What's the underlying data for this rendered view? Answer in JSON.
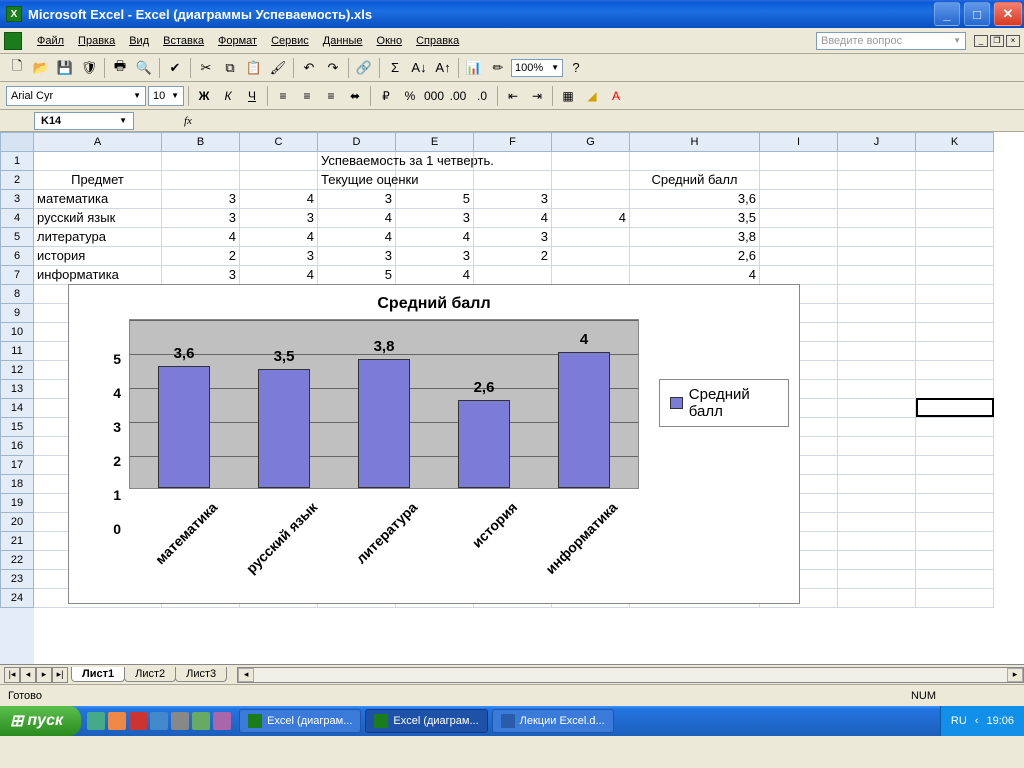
{
  "titlebar": {
    "text": "Microsoft Excel - Excel (диаграммы Успеваемость).xls"
  },
  "menu": {
    "items": [
      "Файл",
      "Правка",
      "Вид",
      "Вставка",
      "Формат",
      "Сервис",
      "Данные",
      "Окно",
      "Справка"
    ],
    "question_placeholder": "Введите вопрос"
  },
  "toolbar": {
    "zoom": "100%"
  },
  "fmtbar": {
    "font": "Arial Cyr",
    "size": "10"
  },
  "formula": {
    "namebox": "K14"
  },
  "columns": [
    "A",
    "B",
    "C",
    "D",
    "E",
    "F",
    "G",
    "H",
    "I",
    "J",
    "K"
  ],
  "rows_visible": 24,
  "active_cell": "K14",
  "sheet_data": {
    "title": "Успеваемость за 1 четверть.",
    "header": {
      "subject": "Предмет",
      "grades": "Текущие оценки",
      "avg": "Средний балл"
    },
    "rows": [
      {
        "subject": "математика",
        "g": [
          "3",
          "4",
          "3",
          "5",
          "3",
          ""
        ],
        "avg": "3,6"
      },
      {
        "subject": "русский язык",
        "g": [
          "3",
          "3",
          "4",
          "3",
          "4",
          "4"
        ],
        "avg": "3,5"
      },
      {
        "subject": "литература",
        "g": [
          "4",
          "4",
          "4",
          "4",
          "3",
          ""
        ],
        "avg": "3,8"
      },
      {
        "subject": "история",
        "g": [
          "2",
          "3",
          "3",
          "3",
          "2",
          ""
        ],
        "avg": "2,6"
      },
      {
        "subject": "информатика",
        "g": [
          "3",
          "4",
          "5",
          "4",
          "",
          ""
        ],
        "avg": "4"
      }
    ]
  },
  "chart_data": {
    "type": "bar",
    "title": "Средний балл",
    "categories": [
      "математика",
      "русский язык",
      "литература",
      "история",
      "информатика"
    ],
    "values": [
      3.6,
      3.5,
      3.8,
      2.6,
      4
    ],
    "value_labels": [
      "3,6",
      "3,5",
      "3,8",
      "2,6",
      "4"
    ],
    "ylim": [
      0,
      5
    ],
    "yticks": [
      0,
      1,
      2,
      3,
      4,
      5
    ],
    "legend": "Средний балл",
    "bar_color": "#7b7bd8"
  },
  "sheets": {
    "tabs": [
      "Лист1",
      "Лист2",
      "Лист3"
    ],
    "active": 0
  },
  "statusbar": {
    "ready": "Готово",
    "num": "NUM"
  },
  "taskbar": {
    "start": "пуск",
    "items": [
      {
        "label": "Excel (диаграм...",
        "active": false
      },
      {
        "label": "Excel (диаграм...",
        "active": true
      },
      {
        "label": "Лекции Excel.d...",
        "active": false
      }
    ],
    "lang": "RU",
    "time": "19:06"
  }
}
